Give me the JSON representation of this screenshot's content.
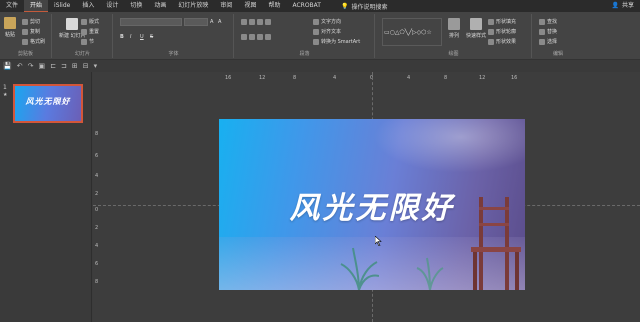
{
  "tabs": [
    "文件",
    "开始",
    "iSlide",
    "插入",
    "设计",
    "切换",
    "动画",
    "幻灯片放映",
    "审阅",
    "视图",
    "帮助",
    "ACROBAT"
  ],
  "active_tab": "开始",
  "tell_me": "操作说明搜索",
  "share": "共享",
  "ribbon": {
    "clipboard": {
      "label": "剪贴板",
      "paste": "粘贴",
      "cut": "剪切",
      "copy": "复制",
      "format": "格式刷"
    },
    "slides": {
      "label": "幻灯片",
      "new": "新建\n幻灯片",
      "layout": "版式",
      "reset": "重置",
      "section": "节"
    },
    "font": {
      "label": "字体",
      "bold": "B",
      "italic": "I",
      "underline": "U",
      "strike": "S",
      "size_up": "A",
      "size_down": "A"
    },
    "paragraph": {
      "label": "段落",
      "direction": "文字方向",
      "align": "对齐文本",
      "smartart": "转换为 SmartArt"
    },
    "drawing": {
      "label": "绘图",
      "arrange": "排列",
      "quick_styles": "快速样式",
      "fill": "形状填充",
      "outline": "形状轮廓",
      "effects": "形状效果"
    },
    "editing": {
      "label": "编辑",
      "find": "查找",
      "replace": "替换",
      "select": "选择"
    }
  },
  "thumbnail": {
    "number": "1",
    "star": "★",
    "text": "风光无限好"
  },
  "slide": {
    "title": "风光无限好"
  },
  "ruler_h": [
    "16",
    "12",
    "8",
    "4",
    "0",
    "4",
    "8",
    "12",
    "16"
  ],
  "ruler_v": [
    "8",
    "6",
    "4",
    "2",
    "0",
    "2",
    "4",
    "6",
    "8"
  ],
  "colors": {
    "accent": "#d2563a",
    "slide_start": "#18b0f0",
    "slide_end": "#5a4c8a"
  }
}
